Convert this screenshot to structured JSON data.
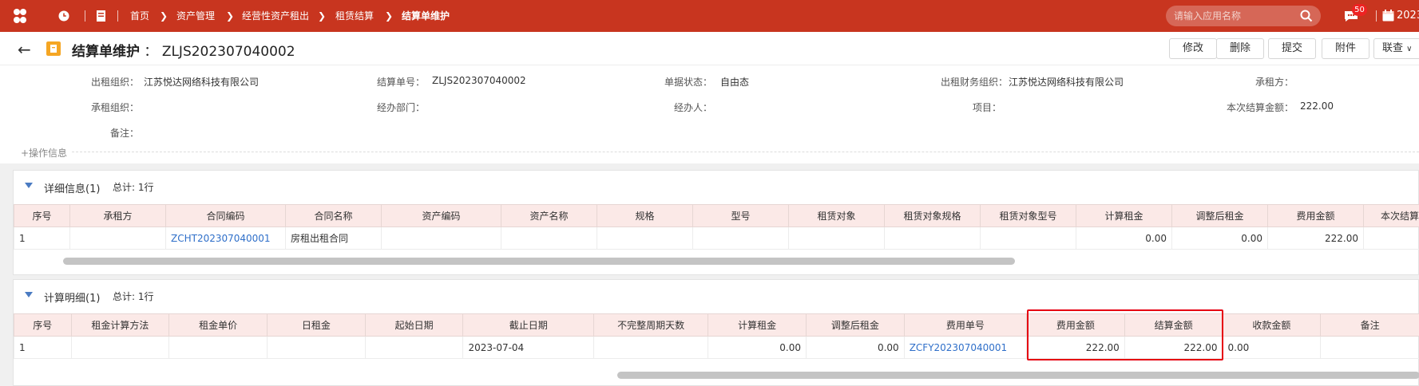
{
  "topbar": {
    "breadcrumb": [
      "首页",
      "资产管理",
      "经营性资产租出",
      "租赁结算",
      "结算单维护"
    ],
    "search_placeholder": "请输入应用名称",
    "notification_count": "50",
    "date_fragment": "2023-"
  },
  "header": {
    "title_main": "结算单维护",
    "title_sep": "：",
    "doc_no": "ZLJS202307040002",
    "buttons": [
      "修改",
      "删除",
      "提交",
      "附件",
      "联查"
    ]
  },
  "form": {
    "row1": [
      {
        "label": "出租组织：",
        "value": "江苏悦达网络科技有限公司"
      },
      {
        "label": "结算单号：",
        "value": "ZLJS202307040002"
      },
      {
        "label": "单据状态：",
        "value": "自由态"
      },
      {
        "label": "出租财务组织：",
        "value": "江苏悦达网络科技有限公司"
      },
      {
        "label": "承租方：",
        "value": ""
      }
    ],
    "row2": [
      {
        "label": "承租组织：",
        "value": ""
      },
      {
        "label": "经办部门：",
        "value": ""
      },
      {
        "label": "经办人：",
        "value": ""
      },
      {
        "label": "项目：",
        "value": ""
      },
      {
        "label": "本次结算金额：",
        "value": "222.00"
      }
    ],
    "row3": [
      {
        "label": "备注：",
        "value": ""
      }
    ],
    "op_info": "+操作信息"
  },
  "detail": {
    "title": "详细信息(1)",
    "total": "总计: 1行",
    "columns": [
      "序号",
      "承租方",
      "合同编码",
      "合同名称",
      "资产编码",
      "资产名称",
      "规格",
      "型号",
      "租赁对象",
      "租赁对象规格",
      "租赁对象型号",
      "计算租金",
      "调整后租金",
      "费用金额",
      "本次结算"
    ],
    "rows": [
      [
        "1",
        "",
        "ZCHT202307040001",
        "房租出租合同",
        "",
        "",
        "",
        "",
        "",
        "",
        "",
        "0.00",
        "0.00",
        "222.00",
        ""
      ]
    ]
  },
  "calc": {
    "title": "计算明细(1)",
    "total": "总计: 1行",
    "columns": [
      "序号",
      "租金计算方法",
      "租金单价",
      "日租金",
      "起始日期",
      "截止日期",
      "不完整周期天数",
      "计算租金",
      "调整后租金",
      "费用单号",
      "费用金额",
      "结算金额",
      "收款金额",
      "备注"
    ],
    "rows": [
      [
        "1",
        "",
        "",
        "",
        "",
        "2023-07-04",
        "",
        "0.00",
        "0.00",
        "ZCFY202307040001",
        "222.00",
        "222.00",
        "0.00",
        ""
      ]
    ]
  },
  "colors": {
    "brand": "#c8351f",
    "table_header": "#fbe9e7",
    "link": "#2f6fc9",
    "highlight": "#e60012"
  }
}
